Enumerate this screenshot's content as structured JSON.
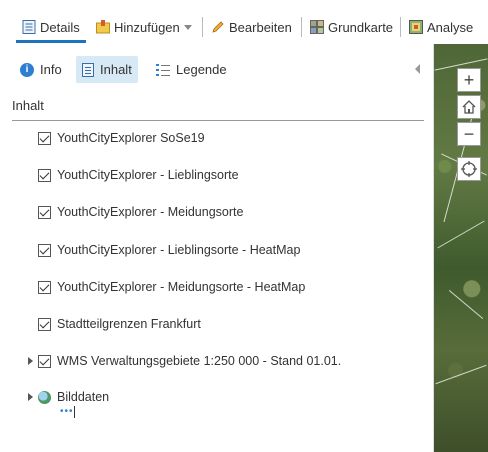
{
  "toolbar": {
    "details": "Details",
    "add": "Hinzufügen",
    "edit": "Bearbeiten",
    "basemap": "Grundkarte",
    "analysis": "Analyse"
  },
  "panel": {
    "tabs": {
      "info": "Info",
      "content": "Inhalt",
      "legend": "Legende"
    },
    "section_title": "Inhalt",
    "layers": [
      {
        "label": "YouthCityExplorer SoSe19",
        "checked": true,
        "expandable": false
      },
      {
        "label": "YouthCityExplorer - Lieblingsorte",
        "checked": true,
        "expandable": false
      },
      {
        "label": "YouthCityExplorer - Meidungsorte",
        "checked": true,
        "expandable": false
      },
      {
        "label": "YouthCityExplorer - Lieblingsorte - HeatMap",
        "checked": true,
        "expandable": false
      },
      {
        "label": "YouthCityExplorer - Meidungsorte - HeatMap",
        "checked": true,
        "expandable": false
      },
      {
        "label": "Stadtteilgrenzen Frankfurt",
        "checked": true,
        "expandable": false
      },
      {
        "label": "WMS Verwaltungsgebiete 1:250 000 - Stand 01.01.",
        "checked": true,
        "expandable": true
      },
      {
        "label": "Bilddaten",
        "checked": null,
        "expandable": true
      }
    ],
    "loading_indicator": "•••"
  },
  "map": {
    "zoom_in": "+",
    "zoom_out": "−"
  },
  "colors": {
    "accent": "#1e73be",
    "tab_active_bg": "#d8e9f6"
  }
}
